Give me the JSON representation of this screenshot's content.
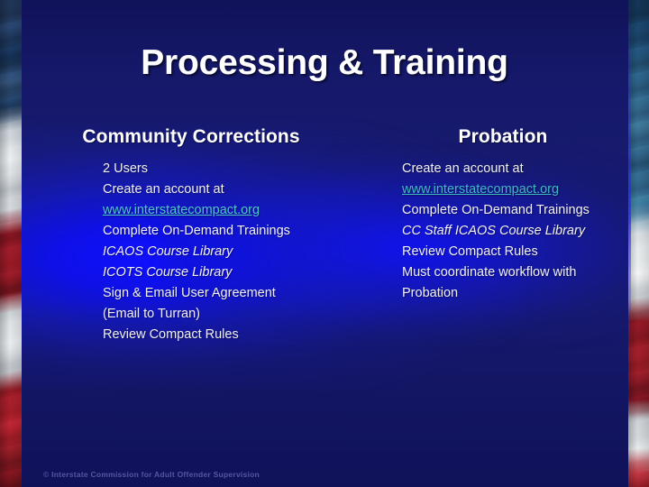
{
  "slide": {
    "title": "Processing & Training",
    "footer": "© Interstate Commission for Adult Offender Supervision",
    "colors": {
      "background": "#171a6e",
      "glow": "#1010ff",
      "title_text": "#ffffff",
      "body_text": "#f2f2f2",
      "link": "#4ec8c8",
      "footer_text": "#5a5fa8"
    }
  },
  "columns": [
    {
      "heading": "Community Corrections",
      "items": [
        {
          "text": "2 Users",
          "style": "plain"
        },
        {
          "text": "Create an account at",
          "style": "plain"
        },
        {
          "text": "www.interstatecompact.org",
          "style": "link"
        },
        {
          "text": "Complete On-Demand Trainings",
          "style": "plain"
        },
        {
          "text": "ICAOS Course Library",
          "style": "italic"
        },
        {
          "text": "ICOTS Course Library",
          "style": "italic"
        },
        {
          "text": "Sign & Email User Agreement",
          "style": "plain"
        },
        {
          "text": "(Email to Turran)",
          "style": "plain"
        },
        {
          "text": "Review Compact Rules",
          "style": "plain"
        }
      ]
    },
    {
      "heading": "Probation",
      "items": [
        {
          "text": "Create an account at",
          "style": "plain"
        },
        {
          "text": "www.interstatecompact.org",
          "style": "link"
        },
        {
          "text": "Complete On-Demand Trainings",
          "style": "plain"
        },
        {
          "text": "CC Staff ICAOS Course Library",
          "style": "italic"
        },
        {
          "text": "Review Compact Rules",
          "style": "plain"
        },
        {
          "text": "Must coordinate workflow with Probation",
          "style": "wrap"
        }
      ]
    }
  ]
}
